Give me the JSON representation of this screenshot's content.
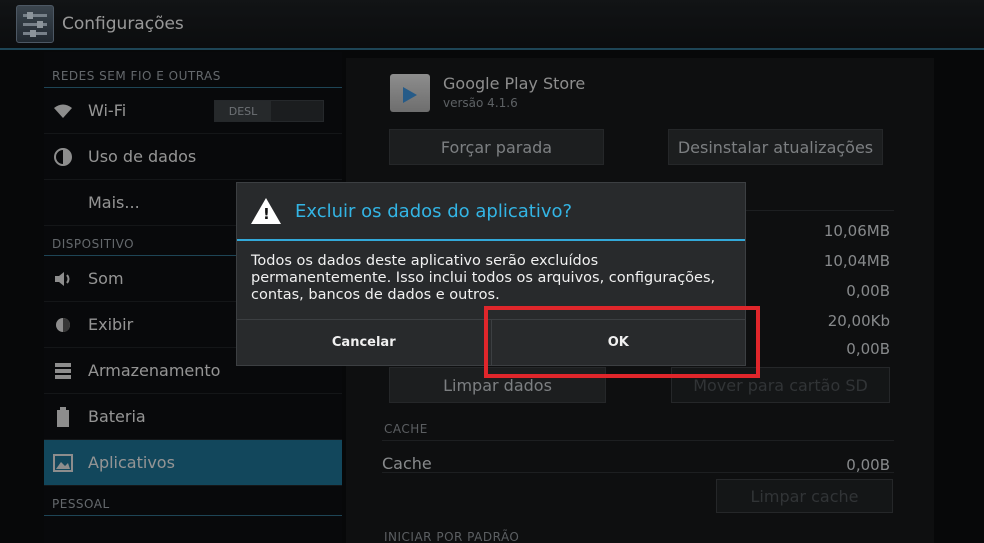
{
  "actionbar": {
    "title": "Configurações",
    "icon": "settings-sliders-icon"
  },
  "sidebar": {
    "sections": [
      {
        "header": "REDES SEM FIO E OUTRAS"
      },
      {
        "header": "DISPOSITIVO"
      },
      {
        "header": "PESSOAL"
      }
    ],
    "items": [
      {
        "label": "Wi-Fi",
        "icon": "wifi-icon",
        "toggle": "DESL"
      },
      {
        "label": "Uso de dados",
        "icon": "data-usage-icon"
      },
      {
        "label": "Mais..."
      },
      {
        "label": "Som",
        "icon": "speaker-icon"
      },
      {
        "label": "Exibir",
        "icon": "brightness-icon"
      },
      {
        "label": "Armazenamento",
        "icon": "storage-icon"
      },
      {
        "label": "Bateria",
        "icon": "battery-icon"
      },
      {
        "label": "Aplicativos",
        "icon": "apps-icon",
        "selected": true
      }
    ]
  },
  "app_info": {
    "name": "Google Play Store",
    "version": "versão 4.1.6",
    "force_stop": "Forçar parada",
    "uninstall_updates": "Desinstalar atualizações",
    "stats": [
      "10,06MB",
      "10,04MB",
      "0,00B",
      "20,00Kb",
      "0,00B"
    ],
    "clear_data": "Limpar dados",
    "move_to_sd": "Mover para cartão SD",
    "cache_header": "CACHE",
    "cache_label": "Cache",
    "cache_value": "0,00B",
    "clear_cache": "Limpar cache",
    "default_header": "INICIAR POR PADRÃO"
  },
  "dialog": {
    "title": "Excluir os dados do aplicativo?",
    "body": "Todos os dados deste aplicativo serão excluídos permanentemente. Isso inclui todos os arquivos, configurações, contas, bancos de dados e outros.",
    "cancel": "Cancelar",
    "ok": "OK"
  },
  "colors": {
    "accent": "#33b5e5",
    "selected": "#1d6e8e",
    "highlight": "#e0262b"
  }
}
